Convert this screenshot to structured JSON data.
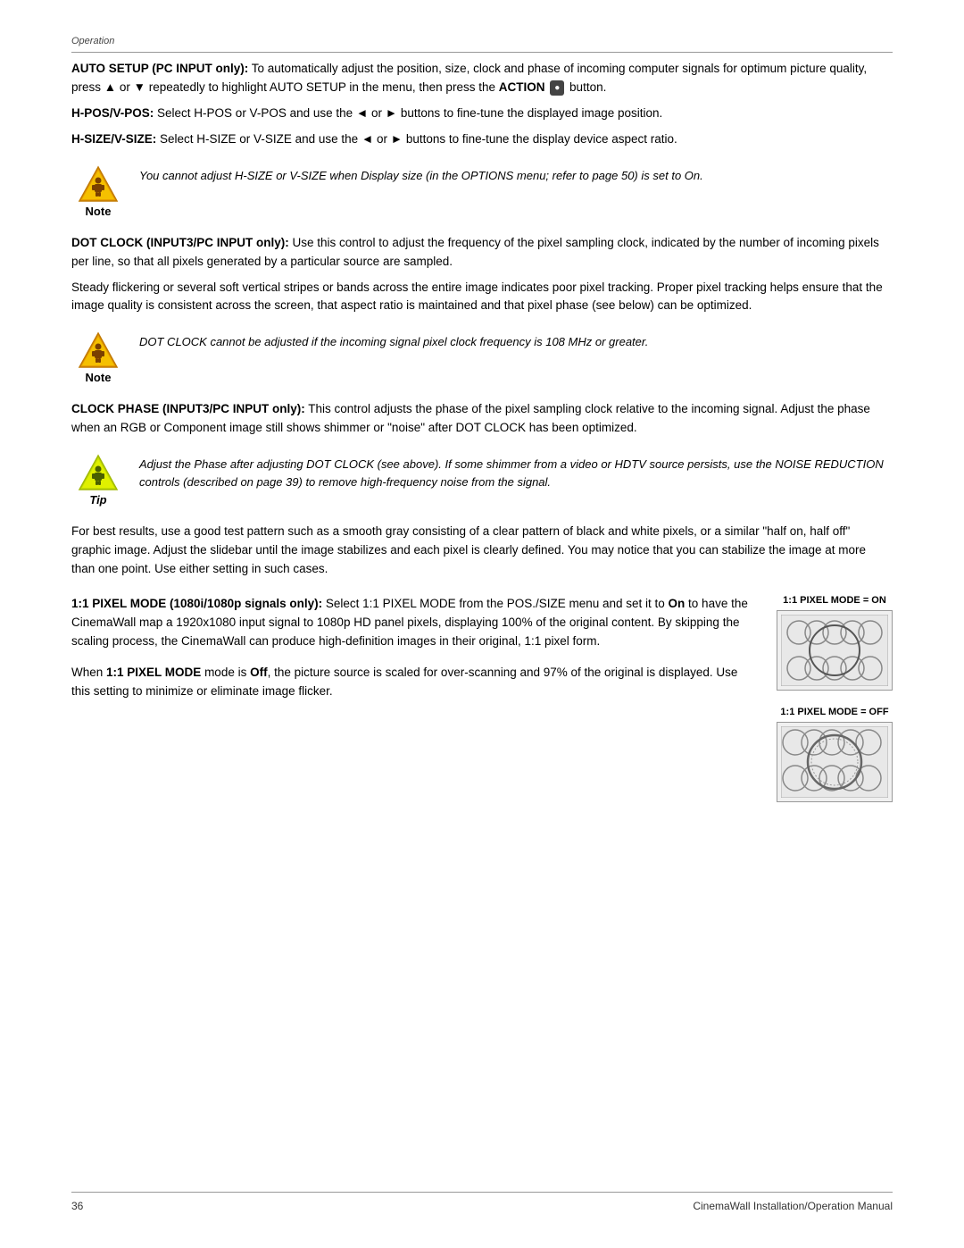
{
  "header": {
    "label": "Operation",
    "divider": true
  },
  "footer": {
    "page_number": "36",
    "manual_title": "CinemaWall Installation/Operation Manual"
  },
  "sections": [
    {
      "id": "auto-setup",
      "bold_prefix": "AUTO SETUP (PC INPUT only):",
      "text": " To automatically adjust the position, size, clock and phase of incoming computer signals for optimum picture quality, press ▲ or ▼ repeatedly to highlight AUTO SETUP in the menu, then press the ",
      "bold_action": "ACTION",
      "action_icon": true,
      "text_after": " button."
    },
    {
      "id": "hpos-vpos",
      "bold_prefix": "H-POS/V-POS:",
      "text": " Select H-POS or V-POS and use the ◄ or ► buttons to fine-tune the displayed image position."
    },
    {
      "id": "hsize-vsize",
      "bold_prefix": "H-SIZE/V-SIZE:",
      "text": " Select H-SIZE or V-SIZE and use the ◄ or ► buttons to fine-tune the display device aspect ratio."
    }
  ],
  "note1": {
    "type": "note",
    "label": "Note",
    "text": "You cannot adjust H-SIZE or V-SIZE when Display size (in the OPTIONS menu; refer to page 50) is set to On."
  },
  "dot_clock": {
    "bold_prefix": "DOT CLOCK (INPUT3/PC INPUT only):",
    "text": " Use this control to adjust the frequency of the pixel sampling clock, indicated by the number of incoming pixels per line, so that all pixels generated by a particular source are sampled.",
    "paragraph2": "Steady flickering or several soft vertical stripes or bands across the entire image indicates poor pixel tracking. Proper pixel tracking helps ensure that the image quality is consistent across the screen, that aspect ratio is maintained and that pixel phase (see below) can be optimized."
  },
  "note2": {
    "type": "note",
    "label": "Note",
    "text": "DOT CLOCK cannot be adjusted if the incoming signal pixel clock frequency is 108 MHz or greater."
  },
  "clock_phase": {
    "bold_prefix": "CLOCK PHASE (INPUT3/PC INPUT only):",
    "text": " This control adjusts the phase of the pixel sampling clock relative to the incoming signal. Adjust the phase when an RGB or Component image still shows shimmer or \"noise\" after DOT CLOCK has been optimized."
  },
  "tip1": {
    "type": "tip",
    "label": "Tip",
    "text": "Adjust the Phase after adjusting DOT CLOCK (see above). If some shimmer from a video or HDTV source persists, use the NOISE REDUCTION controls (described on page 39) to remove high-frequency noise from the signal."
  },
  "best_results": {
    "text": "For best results, use a good test pattern such as a smooth gray consisting of a clear pattern of black and white pixels, or a similar \"half on, half off\" graphic image. Adjust the slidebar until the image stabilizes and each pixel is clearly defined. You may notice that you can stabilize the image at more than one point. Use either setting in such cases."
  },
  "pixel_mode_on": {
    "bold_prefix": "1:1 PIXEL MODE (1080i/1080p signals only):",
    "text": " Select 1:1 PIXEL MODE from the POS./SIZE menu and set it to ",
    "bold_on": "On",
    "text2": " to have the CinemaWall map a 1920x1080 input signal to 1080p HD panel pixels, displaying 100% of the original content. By skipping the scaling process, the CinemaWall can produce high-definition images in their original, 1:1 pixel form.",
    "image_label": "1:1 PIXEL MODE = ON"
  },
  "pixel_mode_off": {
    "text_prefix": "When ",
    "bold_prefix": "1:1 PIXEL MODE",
    "text": " mode is ",
    "bold_off": "Off",
    "text2": ", the picture source is scaled for over-scanning and 97% of the original is displayed. Use this setting to minimize or eliminate image flicker.",
    "image_label": "1:1 PIXEL MODE = OFF"
  }
}
